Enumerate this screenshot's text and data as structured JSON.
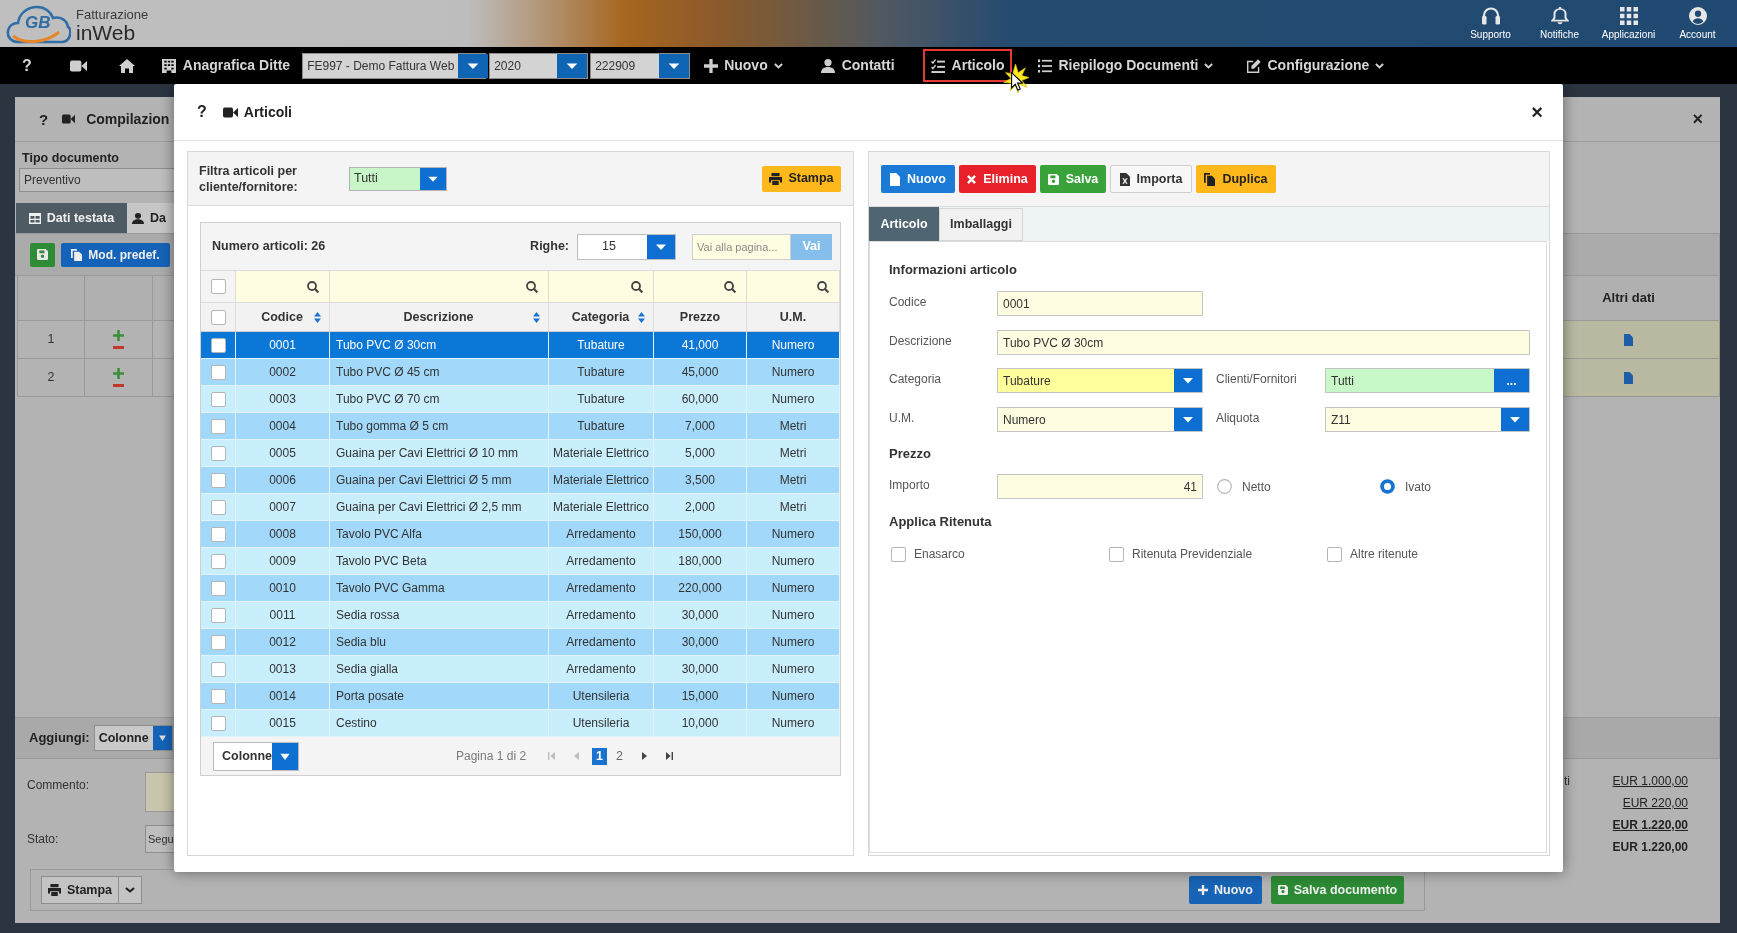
{
  "header": {
    "logo": {
      "mark": "GB",
      "line_1": "Fatturazione",
      "line_2": "inWeb"
    },
    "actions": [
      {
        "label": "Supporto"
      },
      {
        "label": "Notifiche"
      },
      {
        "label": "Applicazioni"
      },
      {
        "label": "Account"
      }
    ]
  },
  "nav": {
    "help": "?",
    "items": [
      {
        "kind": "link",
        "label": "Anagrafica Ditte",
        "highlighted": false
      },
      {
        "kind": "select",
        "value": "FE997 - Demo Fattura Web",
        "highlighted": false
      },
      {
        "kind": "select",
        "value": "2020",
        "highlighted": false
      },
      {
        "kind": "select",
        "value": "222909",
        "highlighted": false
      },
      {
        "kind": "menu",
        "label": "Nuovo",
        "highlighted": false
      },
      {
        "kind": "link",
        "label": "Contatti",
        "highlighted": false
      },
      {
        "kind": "link",
        "label": "Articolo",
        "highlighted": true
      },
      {
        "kind": "menu",
        "label": "Riepilogo Documenti",
        "highlighted": false
      },
      {
        "kind": "menu",
        "label": "Configurazione",
        "highlighted": false
      }
    ]
  },
  "document_window": {
    "help": "?",
    "title": "Compilazion",
    "close": "×",
    "doc_type": {
      "label": "Tipo documento",
      "value": "Preventivo"
    },
    "tabs": [
      {
        "label": "Dati testata",
        "selected": true
      },
      {
        "label": "Da",
        "selected": false
      }
    ],
    "preset_button": "Mod. predef.",
    "rows": [
      {
        "number": "1"
      },
      {
        "number": "2"
      }
    ],
    "extra_column": "Altri dati",
    "add": {
      "label": "Aggiungi:",
      "value": "Colonne"
    },
    "comment_label": "Commento:",
    "status": {
      "label": "Stato:",
      "value": "Segu"
    },
    "print_button": "Stampa",
    "totals_label": "ti",
    "totals": [
      {
        "value": "EUR 1.000,00",
        "kind": "link"
      },
      {
        "value": "EUR 220,00",
        "kind": "link"
      },
      {
        "value": "EUR 1.220,00",
        "kind": "bold_link"
      },
      {
        "value": "EUR 1.220,00",
        "kind": "bold"
      }
    ],
    "buttons": [
      {
        "label": "Nuovo",
        "kind": "primary"
      },
      {
        "label": "Salva documento",
        "kind": "success"
      }
    ]
  },
  "articles_dialog": {
    "help": "?",
    "title": "Articoli",
    "close": "×",
    "filter": {
      "label": "Filtra articoli per cliente/fornitore:",
      "value": "Tutti",
      "print_button": "Stampa"
    },
    "grid": {
      "count": "Numero articoli: 26",
      "rows_label": "Righe:",
      "rows_value": "15",
      "goto_placeholder": "Vai alla pagina...",
      "goto_button": "Vai",
      "select_all": [
        {
          "checked": false
        },
        {
          "checked": false
        }
      ],
      "columns": [
        {
          "label": "Codice",
          "sortable": true
        },
        {
          "label": "Descrizione",
          "sortable": true
        },
        {
          "label": "Categoria",
          "sortable": true
        },
        {
          "label": "Prezzo",
          "sortable": false
        },
        {
          "label": "U.M.",
          "sortable": false
        }
      ],
      "rows": [
        {
          "cells": [
            "0001",
            "Tubo PVC Ø 30cm",
            "Tubature",
            "41,000",
            "Numero"
          ],
          "selected": true,
          "checked": false
        },
        {
          "cells": [
            "0002",
            "Tubo PVC Ø 45 cm",
            "Tubature",
            "45,000",
            "Numero"
          ],
          "selected": false,
          "checked": false
        },
        {
          "cells": [
            "0003",
            "Tubo PVC Ø 70 cm",
            "Tubature",
            "60,000",
            "Numero"
          ],
          "selected": false,
          "checked": false
        },
        {
          "cells": [
            "0004",
            "Tubo gomma Ø 5 cm",
            "Tubature",
            "7,000",
            "Metri"
          ],
          "selected": false,
          "checked": false
        },
        {
          "cells": [
            "0005",
            "Guaina per Cavi Elettrici Ø 10 mm",
            "Materiale Elettrico",
            "5,000",
            "Metri"
          ],
          "selected": false,
          "checked": false
        },
        {
          "cells": [
            "0006",
            "Guaina per Cavi Elettrici Ø 5 mm",
            "Materiale Elettrico",
            "3,500",
            "Metri"
          ],
          "selected": false,
          "checked": false
        },
        {
          "cells": [
            "0007",
            "Guaina per Cavi Elettrici Ø 2,5 mm",
            "Materiale Elettrico",
            "2,000",
            "Metri"
          ],
          "selected": false,
          "checked": false
        },
        {
          "cells": [
            "0008",
            "Tavolo PVC Alfa",
            "Arredamento",
            "150,000",
            "Numero"
          ],
          "selected": false,
          "checked": false
        },
        {
          "cells": [
            "0009",
            "Tavolo PVC Beta",
            "Arredamento",
            "180,000",
            "Numero"
          ],
          "selected": false,
          "checked": false
        },
        {
          "cells": [
            "0010",
            "Tavolo PVC Gamma",
            "Arredamento",
            "220,000",
            "Numero"
          ],
          "selected": false,
          "checked": false
        },
        {
          "cells": [
            "0011",
            "Sedia rossa",
            "Arredamento",
            "30,000",
            "Numero"
          ],
          "selected": false,
          "checked": false
        },
        {
          "cells": [
            "0012",
            "Sedia blu",
            "Arredamento",
            "30,000",
            "Numero"
          ],
          "selected": false,
          "checked": false
        },
        {
          "cells": [
            "0013",
            "Sedia gialla",
            "Arredamento",
            "30,000",
            "Numero"
          ],
          "selected": false,
          "checked": false
        },
        {
          "cells": [
            "0014",
            "Porta posate",
            "Utensileria",
            "15,000",
            "Numero"
          ],
          "selected": false,
          "checked": false
        },
        {
          "cells": [
            "0015",
            "Cestino",
            "Utensileria",
            "10,000",
            "Numero"
          ],
          "selected": false,
          "checked": false
        }
      ],
      "columns_select": "Colonne",
      "page_info": "Pagina 1 di 2",
      "pages": [
        {
          "label": "1",
          "selected": true
        },
        {
          "label": "2",
          "selected": false
        }
      ]
    },
    "editor": {
      "buttons": [
        {
          "label": "Nuovo",
          "kind": "primary"
        },
        {
          "label": "Elimina",
          "kind": "danger"
        },
        {
          "label": "Salva",
          "kind": "success"
        },
        {
          "label": "Importa",
          "kind": "default"
        },
        {
          "label": "Duplica",
          "kind": "warning"
        }
      ],
      "tabs": [
        {
          "label": "Articolo",
          "selected": true
        },
        {
          "label": "Imballaggi",
          "selected": false
        }
      ],
      "info_title": "Informazioni articolo",
      "code": {
        "label": "Codice",
        "value": "0001"
      },
      "description": {
        "label": "Descrizione",
        "value": "Tubo PVC Ø 30cm"
      },
      "category": {
        "label": "Categoria",
        "value": "Tubature"
      },
      "clients": {
        "label": "Clienti/Fornitori",
        "value": "Tutti",
        "button": "..."
      },
      "unit": {
        "label": "U.M.",
        "value": "Numero"
      },
      "vat": {
        "label": "Aliquota",
        "value": "Z11"
      },
      "price_title": "Prezzo",
      "amount": {
        "label": "Importo",
        "value": "41"
      },
      "price_modes": [
        {
          "label": "Netto",
          "selected": false
        },
        {
          "label": "Ivato",
          "selected": true
        }
      ],
      "withholding_title": "Applica Ritenuta",
      "withholdings": [
        {
          "label": "Enasarco",
          "checked": false
        },
        {
          "label": "Ritenuta Previdenziale",
          "checked": false
        },
        {
          "label": "Altre ritenute",
          "checked": false
        }
      ]
    }
  }
}
